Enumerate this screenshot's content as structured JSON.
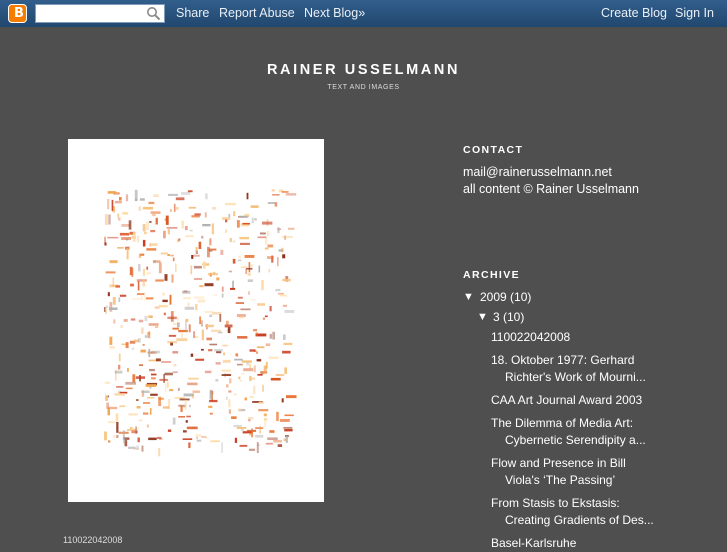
{
  "navbar": {
    "logo_letter": "B",
    "search_placeholder": "",
    "links": {
      "share": "Share",
      "report_abuse": "Report Abuse",
      "next_blog": "Next Blog»",
      "create_blog": "Create Blog",
      "sign_in": "Sign In"
    }
  },
  "header": {
    "title": "RAINER USSELMANN",
    "description": "TEXT AND IMAGES"
  },
  "post": {
    "caption": "110022042008"
  },
  "sidebar": {
    "contact": {
      "title": "CONTACT",
      "email": "mail@rainerusselmann.net",
      "copyright": "all content © Rainer Usselmann"
    },
    "archive": {
      "title": "ARCHIVE",
      "year_toggle": "▼",
      "year": "2009 (10)",
      "month_toggle": "▼",
      "month": "3 (10)",
      "posts": [
        {
          "line1": "110022042008"
        },
        {
          "line1": "18. Oktober 1977: Gerhard",
          "line2": "Richter's Work of Mourni..."
        },
        {
          "line1": "CAA Art Journal Award 2003"
        },
        {
          "line1": "The Dilemma of Media Art:",
          "line2": "Cybernetic Serendipity a..."
        },
        {
          "line1": "Flow and Presence in Bill",
          "line2": "Viola's ‘The Passing’"
        },
        {
          "line1": "From Stasis to Ekstasis:",
          "line2": "Creating Gradients of Des..."
        },
        {
          "line1": "Basel-Karlsruhe"
        }
      ]
    }
  },
  "colors": {
    "background": "#4f4f4f",
    "navbar": "#325e8c",
    "logo": "#f57d00"
  },
  "icons": [
    "blogger-logo-icon",
    "search-icon"
  ]
}
